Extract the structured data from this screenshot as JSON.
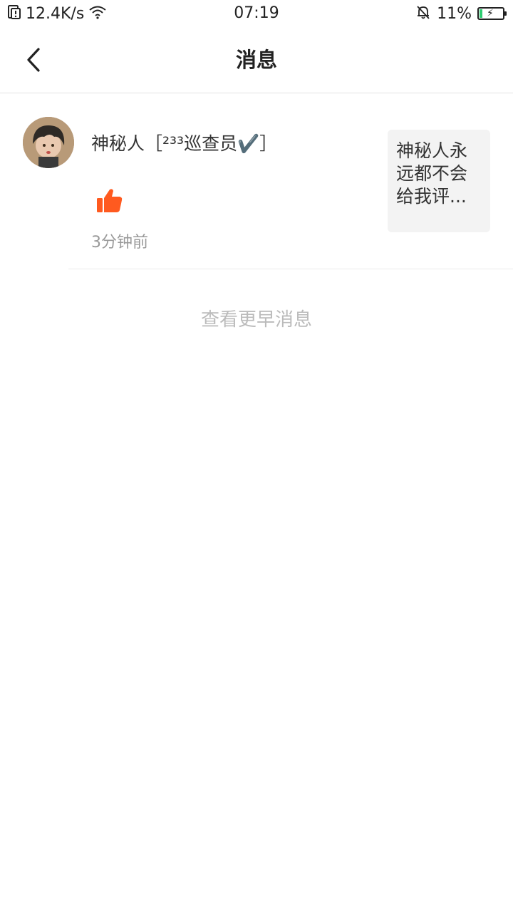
{
  "status_bar": {
    "speed": "12.4K/s",
    "time": "07:19",
    "battery_percent": "11%",
    "battery_level": 0.11,
    "icons": [
      "sim-alert-icon",
      "wifi-icon",
      "bell-muted-icon",
      "battery-charging-icon"
    ]
  },
  "header": {
    "back_icon": "back-arrow-icon",
    "title": "消息"
  },
  "notification": {
    "user_name": "神秘人［²³³巡查员✔️］",
    "action_icon": "thumbs-up-icon",
    "action_color": "#ff5a1f",
    "time_ago": "3分钟前",
    "preview_text": "神秘人永远都不会给我评..."
  },
  "load_more_label": "查看更早消息"
}
